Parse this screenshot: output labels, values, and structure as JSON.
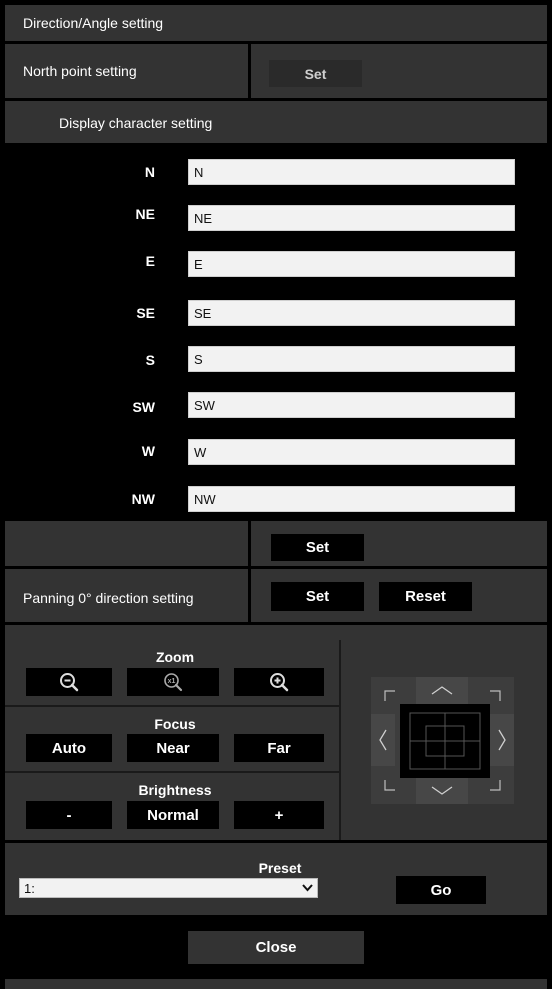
{
  "title": "Direction/Angle setting",
  "north": {
    "label": "North point setting",
    "set_label": "Set"
  },
  "display": {
    "heading": "Display character setting",
    "rows": [
      {
        "label": "N",
        "value": "N"
      },
      {
        "label": "NE",
        "value": "NE"
      },
      {
        "label": "E",
        "value": "E"
      },
      {
        "label": "SE",
        "value": "SE"
      },
      {
        "label": "S",
        "value": "S"
      },
      {
        "label": "SW",
        "value": "SW"
      },
      {
        "label": "W",
        "value": "W"
      },
      {
        "label": "NW",
        "value": "NW"
      }
    ],
    "set_label": "Set"
  },
  "panning": {
    "label": "Panning 0° direction setting",
    "set_label": "Set",
    "reset_label": "Reset"
  },
  "zoom": {
    "title": "Zoom",
    "icons": [
      "zoom-out-icon",
      "zoom-x1-icon",
      "zoom-in-icon"
    ]
  },
  "focus": {
    "title": "Focus",
    "auto": "Auto",
    "near": "Near",
    "far": "Far"
  },
  "brightness": {
    "title": "Brightness",
    "minus": "-",
    "normal": "Normal",
    "plus": "+"
  },
  "preset": {
    "title": "Preset",
    "selected": "1:",
    "go_label": "Go"
  },
  "close_label": "Close",
  "colors": {
    "panel": "#333333",
    "button": "#000000",
    "field": "#f2f2f2"
  }
}
